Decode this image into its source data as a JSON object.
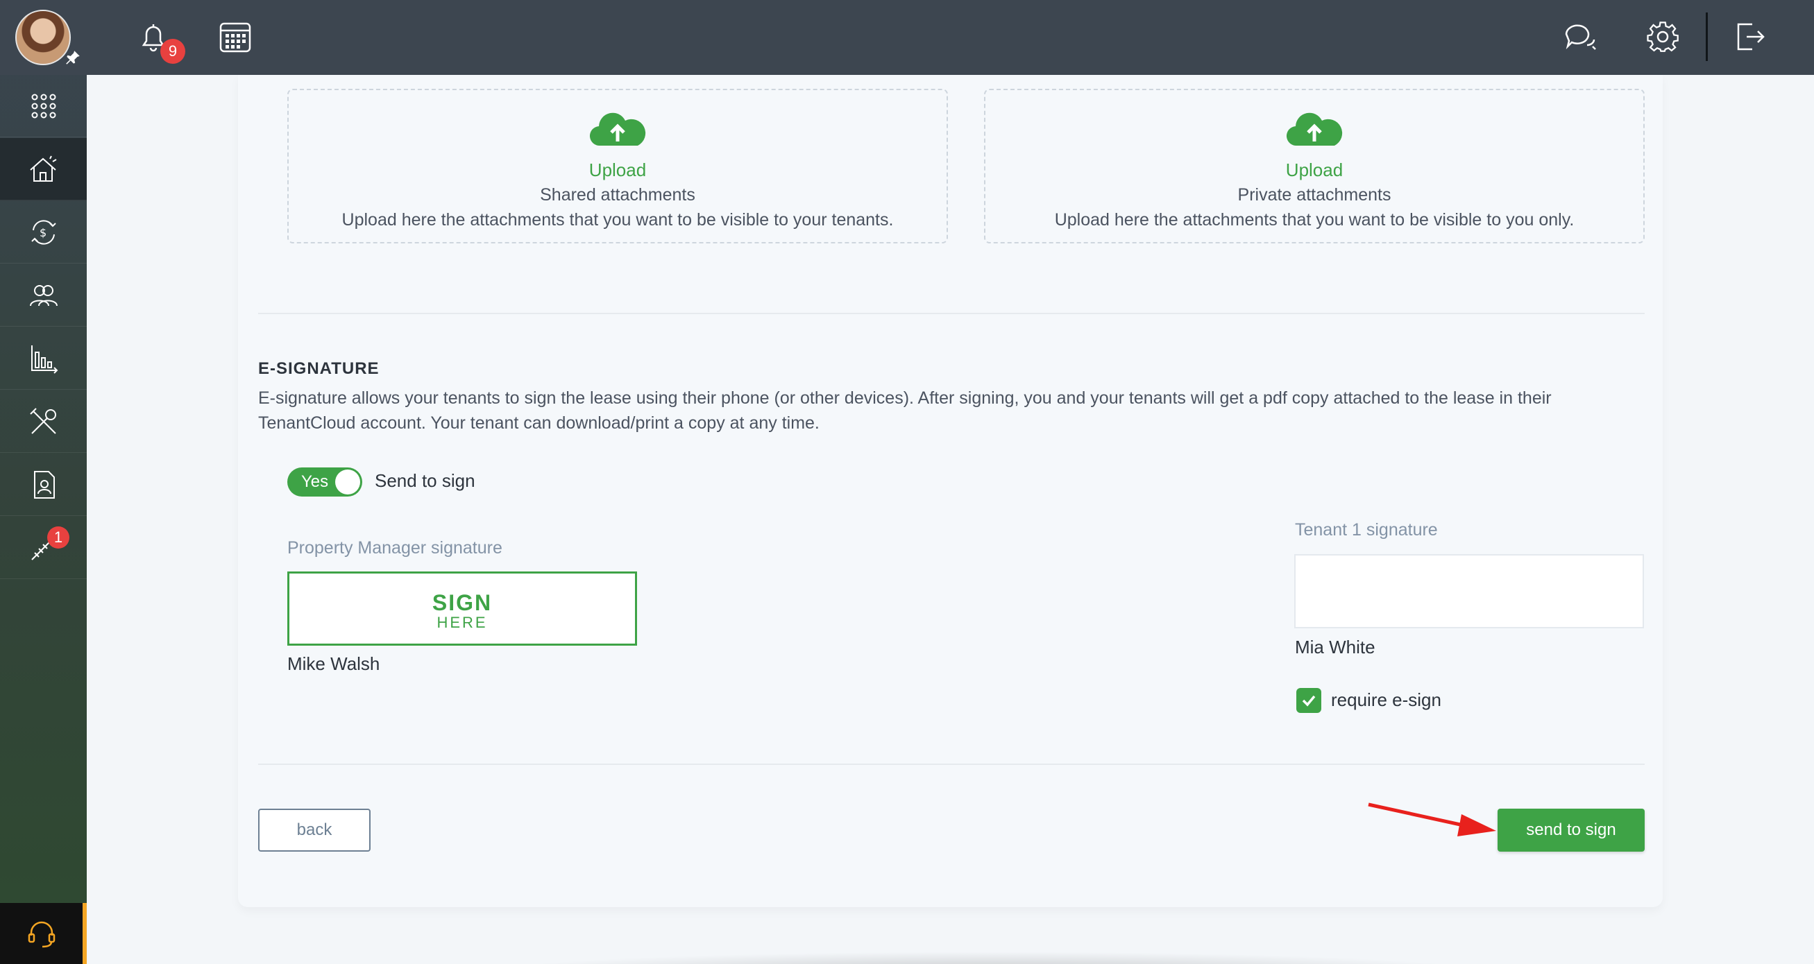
{
  "topbar": {
    "notification_count": "9"
  },
  "sidebar": {
    "items": [
      {
        "icon": "apps-grid-icon"
      },
      {
        "icon": "properties-icon",
        "active": true
      },
      {
        "icon": "accounting-icon"
      },
      {
        "icon": "people-icon"
      },
      {
        "icon": "reports-icon"
      },
      {
        "icon": "maintenance-icon"
      },
      {
        "icon": "leases-icon"
      },
      {
        "icon": "marketing-icon",
        "badge": "1"
      }
    ]
  },
  "uploads": [
    {
      "title": "Upload",
      "subtitle": "Shared attachments",
      "description": "Upload here the attachments that you want to be visible to your tenants."
    },
    {
      "title": "Upload",
      "subtitle": "Private attachments",
      "description": "Upload here the attachments that you want to be visible to you only."
    }
  ],
  "esignature": {
    "heading": "E-SIGNATURE",
    "description": "E-signature allows your tenants to sign the lease using their phone (or other devices). After signing, you and your tenants will get a pdf copy attached to the lease in their TenantCloud account. Your tenant can download/print a copy at any time.",
    "toggle_value": "Yes",
    "toggle_label": "Send to sign",
    "manager": {
      "label": "Property Manager signature",
      "sign_big": "SIGN",
      "sign_small": "HERE",
      "name": "Mike Walsh"
    },
    "tenant": {
      "label": "Tenant 1 signature",
      "name": "Mia White",
      "require_label": "require e-sign",
      "require_checked": true
    }
  },
  "actions": {
    "back_label": "back",
    "send_label": "send to sign"
  },
  "colors": {
    "accent_green": "#3ea346",
    "topbar": "#3d4650",
    "badge_red": "#e8413f",
    "annotation_arrow": "#e8211d"
  }
}
